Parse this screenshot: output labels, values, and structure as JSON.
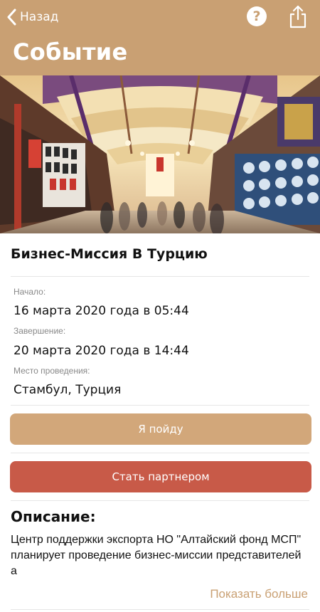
{
  "header": {
    "back_label": "Назад",
    "title": "Событие",
    "help_glyph": "?",
    "icons": [
      "chevron-left-icon",
      "help-icon",
      "share-icon"
    ],
    "background_color": "#c9a073"
  },
  "event": {
    "title": "Бизнес-Миссия В Турцию",
    "start_label": "Начало:",
    "start_value": "16 марта 2020 года в 05:44",
    "end_label": "Завершение:",
    "end_value": "20 марта 2020 года в 14:44",
    "place_label": "Место проведения:",
    "place_value": "Стамбул, Турция"
  },
  "actions": {
    "go_label": "Я пойду",
    "partner_label": "Стать партнером",
    "go_color": "#d2a77a",
    "partner_color": "#c85a48"
  },
  "description": {
    "title": "Описание:",
    "text": "Центр поддержки экспорта НО \"Алтайский фонд МСП\" планирует проведение бизнес-миссии представителей а",
    "more_label": "Показать больше"
  }
}
